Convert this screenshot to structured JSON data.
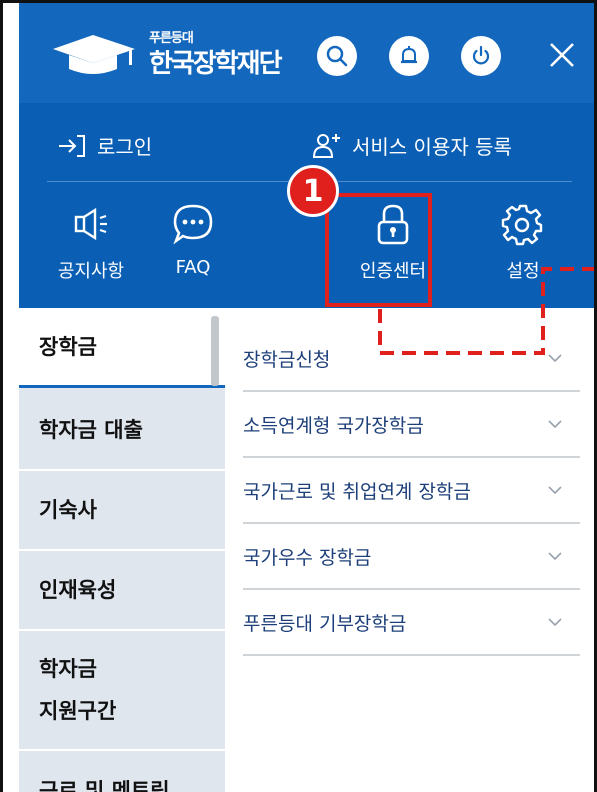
{
  "brand": {
    "tagline": "푸른등대",
    "name": "한국장학재단"
  },
  "top_icons": [
    "search-icon",
    "bell-icon",
    "power-icon",
    "close-icon"
  ],
  "account": {
    "login_label": "로그인",
    "register_label": "서비스 이용자 등록"
  },
  "quick_menu": [
    {
      "label": "공지사항",
      "icon": "megaphone-icon"
    },
    {
      "label": "FAQ",
      "icon": "chat-bubble-icon"
    },
    {
      "label": "인증센터",
      "icon": "lock-icon"
    },
    {
      "label": "설정",
      "icon": "gear-icon"
    }
  ],
  "annotation": {
    "step": "1"
  },
  "sidebar": {
    "items": [
      {
        "label": "장학금",
        "active": true
      },
      {
        "label": "학자금 대출"
      },
      {
        "label": "기숙사"
      },
      {
        "label": "인재육성"
      },
      {
        "label_line1": "학자금",
        "label_line2": "지원구간"
      },
      {
        "label": "근로 및 멘토링"
      }
    ]
  },
  "submenu": {
    "items": [
      {
        "label": "장학금신청"
      },
      {
        "label": "소득연계형 국가장학금"
      },
      {
        "label": "국가근로 및 취업연계 장학금"
      },
      {
        "label": "국가우수 장학금"
      },
      {
        "label": "푸른등대 기부장학금"
      }
    ]
  },
  "colors": {
    "header": "#1367bd",
    "highlight": "#e0201d",
    "sidebar": "#dfe6ee",
    "submenu_text": "#1d3f7a"
  }
}
